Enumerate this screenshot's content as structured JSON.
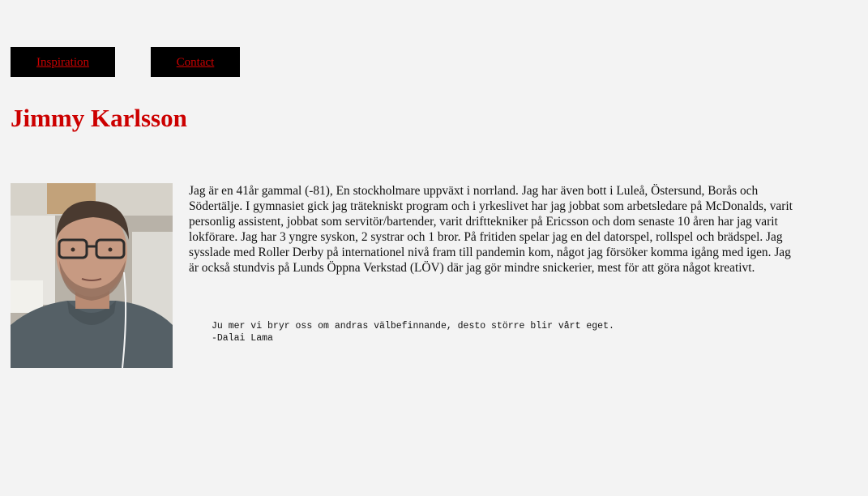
{
  "nav": {
    "items": [
      {
        "label": "Inspiration"
      },
      {
        "label": "Contact"
      }
    ]
  },
  "colors": {
    "accent": "#cc0000",
    "nav_background": "#000000",
    "page_background": "#f3f3f3"
  },
  "header": {
    "title": "Jimmy Karlsson"
  },
  "main": {
    "bio": "Jag är en 41år gammal (-81), En stockholmare uppväxt i norrland. Jag har även bott i Luleå, Östersund, Borås och Södertälje. I gymnasiet gick jag trätekniskt program och i yrkeslivet har jag jobbat som arbetsledare på McDonalds, varit personlig assistent, jobbat som servitör/bartender, varit drifttekniker på Ericsson och dom senaste 10 åren har jag varit lokförare. Jag har 3 yngre syskon, 2 systrar och 1 bror. På fritiden spelar jag en del datorspel, rollspel och brädspel. Jag sysslade med Roller Derby på internationel nivå fram till pandemin kom, något jag försöker komma igång med igen. Jag är också stundvis på Lunds Öppna Verkstad (LÖV) där jag gör mindre snickerier, mest för att göra något kreativt.",
    "quote": {
      "text": "Ju mer vi bryr oss om andras välbefinnande, desto större blir vårt eget.",
      "author": "-Dalai Lama"
    }
  }
}
